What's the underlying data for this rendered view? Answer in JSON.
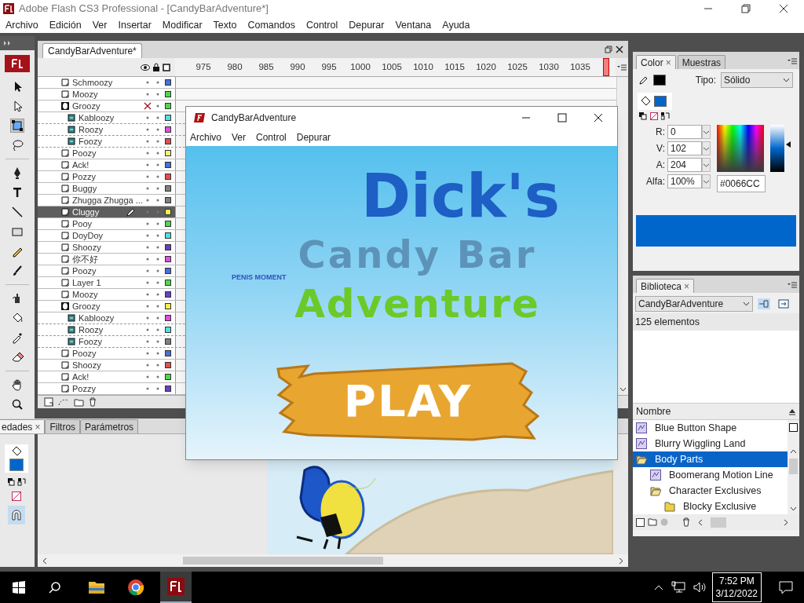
{
  "app_window": {
    "title": "Adobe Flash CS3 Professional - [CandyBarAdventure*]"
  },
  "menu": [
    "Archivo",
    "Edición",
    "Ver",
    "Insertar",
    "Modificar",
    "Texto",
    "Comandos",
    "Control",
    "Depurar",
    "Ventana",
    "Ayuda"
  ],
  "document_tab": {
    "label": "CandyBarAdventure*",
    "selected": true
  },
  "timeline": {
    "frame_numbers": [
      "975",
      "980",
      "985",
      "990",
      "995",
      "1000",
      "1005",
      "1010",
      "1015",
      "1020",
      "1025",
      "1030",
      "1035"
    ],
    "layers": [
      {
        "name": "Schmoozy",
        "kind": "layer",
        "visible": true,
        "selected": false,
        "color": "#4a6fd6"
      },
      {
        "name": "Moozy",
        "kind": "layer",
        "visible": true,
        "selected": false,
        "color": "#4fd64f"
      },
      {
        "name": "Groozy",
        "kind": "mask",
        "visible": false,
        "selected": false,
        "color": "#4fd64f",
        "children": [
          {
            "name": "Kabloozy",
            "kind": "masked",
            "visible": true,
            "selected": false,
            "color": "#4fe0e0"
          },
          {
            "name": "Roozy",
            "kind": "masked",
            "visible": true,
            "selected": false,
            "color": "#e04fe0"
          },
          {
            "name": "Foozy",
            "kind": "masked",
            "visible": true,
            "selected": false,
            "color": "#e04f4f"
          }
        ]
      },
      {
        "name": "Poozy",
        "kind": "layer",
        "visible": true,
        "selected": false,
        "color": "#f0f07a"
      },
      {
        "name": "Ack!",
        "kind": "layer",
        "visible": true,
        "selected": false,
        "color": "#4a6fd6"
      },
      {
        "name": "Pozzy",
        "kind": "layer",
        "visible": true,
        "selected": false,
        "color": "#e04f4f"
      },
      {
        "name": "Buggy",
        "kind": "layer",
        "visible": true,
        "selected": false,
        "color": "#808080"
      },
      {
        "name": "Zhugga Zhugga ...",
        "kind": "layer",
        "visible": true,
        "selected": false,
        "color": "#808080"
      },
      {
        "name": "Cluggy",
        "kind": "layer",
        "visible": true,
        "selected": true,
        "color": "#f0f04f"
      },
      {
        "name": "Pooy",
        "kind": "layer",
        "visible": true,
        "selected": false,
        "color": "#4fd64f"
      },
      {
        "name": "DoyDoy",
        "kind": "layer",
        "visible": true,
        "selected": false,
        "color": "#4fe0e0"
      },
      {
        "name": "Shoozy",
        "kind": "layer",
        "visible": true,
        "selected": false,
        "color": "#6a3fc0"
      },
      {
        "name": "你不好",
        "kind": "layer",
        "visible": true,
        "selected": false,
        "color": "#e04fe0"
      },
      {
        "name": "Poozy",
        "kind": "layer",
        "visible": true,
        "selected": false,
        "color": "#4a6fd6"
      },
      {
        "name": "Layer 1",
        "kind": "layer",
        "visible": true,
        "selected": false,
        "color": "#4fd64f"
      },
      {
        "name": "Moozy",
        "kind": "layer",
        "visible": true,
        "selected": false,
        "color": "#6a3fc0"
      },
      {
        "name": "Groozy",
        "kind": "mask",
        "visible": true,
        "selected": false,
        "color": "#f0f04f",
        "children": [
          {
            "name": "Kabloozy",
            "kind": "masked",
            "visible": true,
            "selected": false,
            "color": "#e04fe0"
          },
          {
            "name": "Roozy",
            "kind": "masked",
            "visible": true,
            "selected": false,
            "color": "#4fe0e0"
          },
          {
            "name": "Foozy",
            "kind": "masked",
            "visible": true,
            "selected": false,
            "color": "#808080"
          }
        ]
      },
      {
        "name": "Poozy",
        "kind": "layer",
        "visible": true,
        "selected": false,
        "color": "#4a6fd6"
      },
      {
        "name": "Shoozy",
        "kind": "layer",
        "visible": true,
        "selected": false,
        "color": "#e04f4f"
      },
      {
        "name": "Ack!",
        "kind": "layer",
        "visible": true,
        "selected": false,
        "color": "#4fd64f"
      },
      {
        "name": "Pozzy",
        "kind": "layer",
        "visible": true,
        "selected": false,
        "color": "#6a3fc0"
      }
    ]
  },
  "properties_tabs": [
    {
      "label": "edades",
      "close": "×",
      "selected": true
    },
    {
      "label": "Filtros",
      "selected": false
    },
    {
      "label": "Parámetros",
      "selected": false
    }
  ],
  "player_window": {
    "title": "CandyBarAdventure",
    "menu": [
      "Archivo",
      "Ver",
      "Control",
      "Depurar"
    ],
    "game": {
      "title_lines": [
        {
          "text": "Dick's",
          "color": "#1d5fc4"
        },
        {
          "text": "Candy Bar",
          "color": "#5d93b8"
        },
        {
          "text": "Adventure",
          "color": "#6cc92a"
        }
      ],
      "tagline": "PENIS MOMENT",
      "play_button": "PLAY"
    }
  },
  "color_panel": {
    "tabs": [
      {
        "label": "Color",
        "close": "×",
        "selected": true
      },
      {
        "label": "Muestras",
        "selected": false
      }
    ],
    "type_label": "Tipo:",
    "type_value": "Sólido",
    "brightness_slider": {
      "level": 0.58
    },
    "fields": [
      {
        "label": "R:",
        "value": "0"
      },
      {
        "label": "V:",
        "value": "102"
      },
      {
        "label": "A:",
        "value": "204"
      },
      {
        "label": "Alfa:",
        "value": "100%"
      }
    ],
    "hex": "#0066CC"
  },
  "library_panel": {
    "tab": {
      "label": "Biblioteca",
      "close": "×"
    },
    "document": "CandyBarAdventure",
    "count": "125 elementos",
    "column": "Nombre",
    "items": [
      {
        "name": "Blue Button Shape",
        "kind": "symbol",
        "selected": false
      },
      {
        "name": "Blurry Wiggling Land",
        "kind": "symbol",
        "selected": false
      },
      {
        "name": "Body Parts",
        "kind": "folder",
        "expanded": true,
        "selected": true,
        "children": [
          {
            "name": "Boomerang Motion Line",
            "kind": "symbol",
            "selected": false
          },
          {
            "name": "Character Exclusives",
            "kind": "folder",
            "expanded": true,
            "selected": false,
            "children": [
              {
                "name": "Blocky Exclusive",
                "kind": "folder",
                "expanded": false,
                "selected": false
              }
            ]
          }
        ]
      }
    ]
  },
  "taskbar": {
    "time": "7:52 PM",
    "date": "3/12/2022"
  }
}
